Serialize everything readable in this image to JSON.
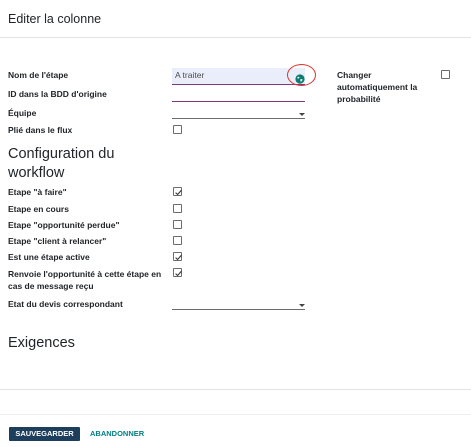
{
  "header": {
    "title": "Editer la colonne"
  },
  "form": {
    "name_label": "Nom de l'étape",
    "name_value": "A traiter",
    "origin_id_label": "ID dans la BDD d'origine",
    "team_label": "Équipe",
    "folded_label": "Plié dans le flux",
    "auto_proba_label": "Changer automatiquement la probabilité"
  },
  "workflow": {
    "title": "Configuration du workflow",
    "todo_label": "Etape \"à faire\"",
    "in_progress_label": "Etape en cours",
    "lost_label": "Etape \"opportunité perdue\"",
    "followup_label": "Etape \"client à relancer\"",
    "active_label": "Est une étape active",
    "resend_label": "Renvoie l'opportunité à cette étape en cas de message reçu",
    "quote_state_label": "Etat du devis correspondant"
  },
  "checks": {
    "folded": false,
    "auto_proba": false,
    "todo": true,
    "in_progress": false,
    "lost": false,
    "followup": false,
    "active": true,
    "resend": true
  },
  "requirements": {
    "title": "Exigences"
  },
  "footer": {
    "save_label": "SAUVEGARDER",
    "discard_label": "ABANDONNER"
  },
  "colors": {
    "primary": "#1d3f5d",
    "link": "#017e84",
    "field_underline": "#7c3a7b",
    "annotation": "#e0302b"
  },
  "icons": {
    "translate": "globe-icon",
    "dropdown": "caret-down-icon",
    "check": "check-icon"
  }
}
